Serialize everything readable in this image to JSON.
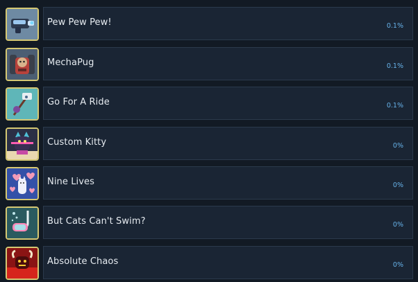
{
  "achievements": [
    {
      "name": "Pew Pew Pew!",
      "percent": "0.1%",
      "icon": "laser-gun-icon",
      "frame": "#d6c873"
    },
    {
      "name": "MechaPug",
      "percent": "0.1%",
      "icon": "mech-pug-icon",
      "frame": "#d6c873"
    },
    {
      "name": "Go For A Ride",
      "percent": "0.1%",
      "icon": "pogo-ride-icon",
      "frame": "#d6c873"
    },
    {
      "name": "Custom Kitty",
      "percent": "0%",
      "icon": "custom-kitty-icon",
      "frame": "#d6c873"
    },
    {
      "name": "Nine Lives",
      "percent": "0%",
      "icon": "nine-lives-icon",
      "frame": "#d6c873"
    },
    {
      "name": "But Cats Can't Swim?",
      "percent": "0%",
      "icon": "snorkel-mask-icon",
      "frame": "#d6c873"
    },
    {
      "name": "Absolute Chaos",
      "percent": "0%",
      "icon": "devil-cat-icon",
      "frame": "#d6c873"
    }
  ]
}
